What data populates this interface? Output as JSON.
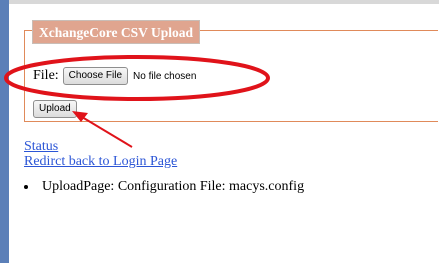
{
  "upload_panel": {
    "legend": "XchangeCore CSV Upload",
    "file_label": "File:",
    "choose_file_label": "Choose File",
    "no_file_text": "No file chosen",
    "upload_label": "Upload"
  },
  "links": {
    "status": "Status",
    "redirect": "Redirct back to Login Page"
  },
  "messages": [
    "UploadPage: Configuration File: macys.config"
  ],
  "annotation": {
    "color": "#e0131a"
  }
}
